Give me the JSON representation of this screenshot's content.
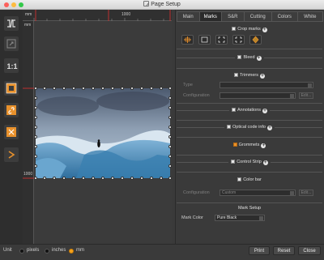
{
  "window": {
    "title": "Page Setup"
  },
  "rulers": {
    "top_label_left": "mm",
    "top_label_right": "1000",
    "left_label_top": "mm",
    "left_label_bottom": "1000"
  },
  "tabs": [
    "Main",
    "Marks",
    "S&R",
    "Cutting",
    "Colors",
    "White"
  ],
  "active_tab": "Marks",
  "sections": {
    "crop_marks": "Crop marks",
    "bleed": "Bleed",
    "trimmers": "Trimmers",
    "annotations": "Annotations",
    "optical_code_info": "Optical code info",
    "grommets": "Grommets",
    "control_strip": "Control Strip",
    "color_bar": "Color bar",
    "mark_setup": "Mark Setup"
  },
  "trimmers": {
    "type_label": "Type",
    "type_value": "",
    "config_label": "Configuration",
    "config_value": "",
    "edit_label": "Edit..."
  },
  "colorbar": {
    "config_label": "Configuration",
    "config_value": "Custom",
    "edit_label": "Edit..."
  },
  "mark_color": {
    "label": "Mark Color",
    "value": "Pure Black"
  },
  "unit": {
    "label": "Unit",
    "options": [
      "pixels",
      "inches",
      "mm"
    ],
    "selected": "mm"
  },
  "buttons": {
    "print": "Print",
    "reset": "Reset",
    "close": "Close"
  },
  "icons": [
    "size-toggle-icon",
    "zoom-fit-icon",
    "actual-size-icon",
    "fit-page-icon",
    "link-icon",
    "center-icon",
    "forward-icon"
  ],
  "accent_color": "#e8912c"
}
